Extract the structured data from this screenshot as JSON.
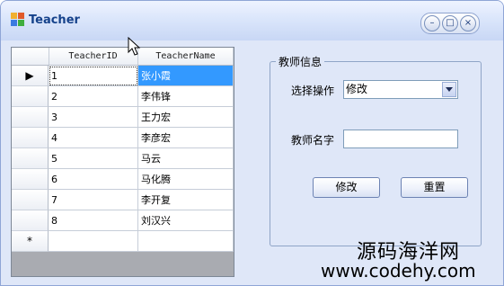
{
  "window": {
    "title": "Teacher"
  },
  "grid": {
    "columns": [
      "TeacherID",
      "TeacherName"
    ],
    "new_row_marker": "*",
    "current_row_marker": "▶",
    "rows": [
      {
        "id": "1",
        "name": "张小霞"
      },
      {
        "id": "2",
        "name": "李伟锋"
      },
      {
        "id": "3",
        "name": "王力宏"
      },
      {
        "id": "4",
        "name": "李彦宏"
      },
      {
        "id": "5",
        "name": "马云"
      },
      {
        "id": "6",
        "name": "马化腾"
      },
      {
        "id": "7",
        "name": "李开复"
      },
      {
        "id": "8",
        "name": "刘汉兴"
      }
    ]
  },
  "group": {
    "title": "教师信息",
    "operation_label": "选择操作",
    "operation_value": "修改",
    "name_label": "教师名字",
    "name_value": ""
  },
  "buttons": {
    "modify": "修改",
    "reset": "重置"
  },
  "watermark": {
    "cn": "源码海洋网",
    "url": "www.codehy.com"
  },
  "colors": {
    "selection": "#3399ff",
    "title_text": "#15428b"
  },
  "icons": {
    "app": "app-icon",
    "minimize": "minimize-icon",
    "maximize": "maximize-icon",
    "close": "close-icon",
    "dropdown": "chevron-down-icon",
    "cursor": "mouse-cursor-icon"
  }
}
